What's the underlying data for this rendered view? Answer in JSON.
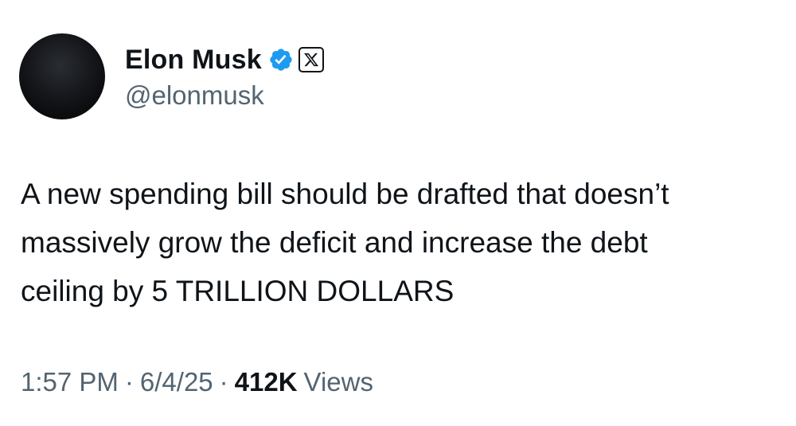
{
  "user": {
    "display_name": "Elon Musk",
    "handle": "@elonmusk",
    "verified_icon": "verified-badge-icon",
    "affiliation_icon": "x-logo-icon",
    "verified_color": "#1d9bf0"
  },
  "tweet": {
    "text": "A new spending bill should be drafted that doesn’t\nmassively grow the deficit and increase the debt\nceiling by 5 TRILLION DOLLARS"
  },
  "meta": {
    "time": "1:57 PM",
    "separator": "·",
    "date": "6/4/25",
    "views_count": "412K",
    "views_label": "Views"
  }
}
